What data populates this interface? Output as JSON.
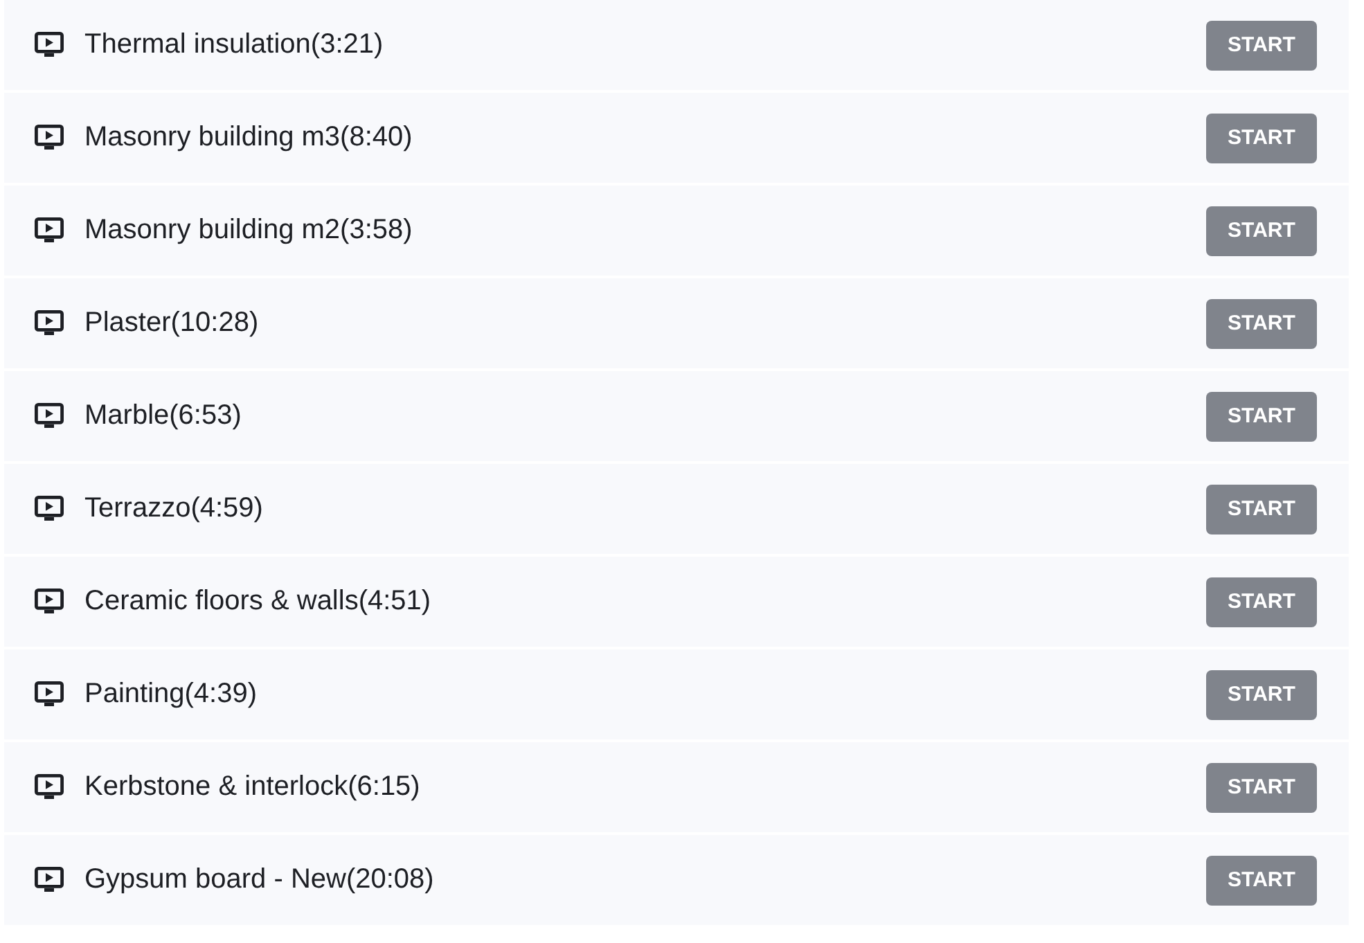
{
  "lectures": [
    {
      "title": "Thermal insulation(3:21)",
      "button": "START"
    },
    {
      "title": "Masonry building m3(8:40)",
      "button": "START"
    },
    {
      "title": "Masonry building m2(3:58)",
      "button": "START"
    },
    {
      "title": "Plaster(10:28)",
      "button": "START"
    },
    {
      "title": "Marble(6:53)",
      "button": "START"
    },
    {
      "title": "Terrazzo(4:59)",
      "button": "START"
    },
    {
      "title": "Ceramic floors & walls(4:51)",
      "button": "START"
    },
    {
      "title": "Painting(4:39)",
      "button": "START"
    },
    {
      "title": "Kerbstone & interlock(6:15)",
      "button": "START"
    },
    {
      "title": "Gypsum board - New(20:08)",
      "button": "START"
    }
  ]
}
